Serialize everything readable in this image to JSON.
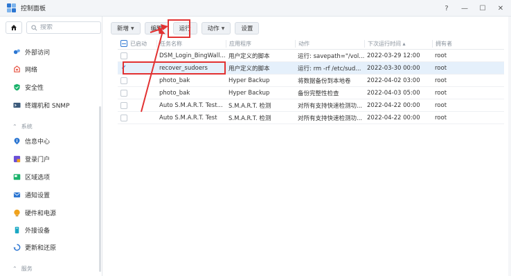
{
  "window": {
    "title": "控制面板"
  },
  "window_controls": {
    "help": "?",
    "minimize": "—",
    "maximize": "☐",
    "close": "✕"
  },
  "sidebar": {
    "search_placeholder": "搜索",
    "partial_top": "外部访问",
    "items": [
      {
        "label": "外部访问",
        "icon": "external-access-icon",
        "color": "#2c76d2"
      },
      {
        "label": "网络",
        "icon": "network-icon",
        "color": "#e7503f"
      },
      {
        "label": "安全性",
        "icon": "security-shield-icon",
        "color": "#1ab26b"
      },
      {
        "label": "终端机和 SNMP",
        "icon": "terminal-icon",
        "color": "#3b5a7a"
      }
    ],
    "section_system": "系统",
    "system_items": [
      {
        "label": "信息中心",
        "icon": "info-center-icon",
        "color": "#2c76d2"
      },
      {
        "label": "登录门户",
        "icon": "login-portal-icon",
        "color": "#6a4fd6"
      },
      {
        "label": "区域选项",
        "icon": "region-icon",
        "color": "#1ab26b"
      },
      {
        "label": "通知设置",
        "icon": "notification-icon",
        "color": "#2c76d2"
      },
      {
        "label": "硬件和电源",
        "icon": "hardware-power-icon",
        "color": "#f0a21c"
      },
      {
        "label": "外接设备",
        "icon": "external-device-icon",
        "color": "#1aa8c4"
      },
      {
        "label": "更新和还原",
        "icon": "update-restore-icon",
        "color": "#2c76d2"
      }
    ],
    "section_services": "服务"
  },
  "toolbar": {
    "create": "新增",
    "edit": "编辑",
    "run": "运行",
    "action": "动作",
    "settings": "设置"
  },
  "table": {
    "headers": {
      "enabled": "已启动",
      "task_name": "任务名称",
      "application": "应用程序",
      "action": "动作",
      "next_run": "下次运行时间",
      "next_run_sort": "▴",
      "owner": "拥有者"
    },
    "rows": [
      {
        "enabled": false,
        "name": "DSM_Login_BingWall...",
        "app": "用户定义的脚本",
        "action": "运行: savepath=\"/vol...",
        "next": "2022-03-29 12:00",
        "owner": "root",
        "selected": false
      },
      {
        "enabled": true,
        "name": "recover_sudoers",
        "app": "用户定义的脚本",
        "action": "运行: rm -rf /etc/sud...",
        "next": "2022-03-30 00:00",
        "owner": "root",
        "selected": true
      },
      {
        "enabled": false,
        "name": "photo_bak",
        "app": "Hyper Backup",
        "action": "将数据备份到本地卷",
        "next": "2022-04-02 03:00",
        "owner": "root",
        "selected": false
      },
      {
        "enabled": false,
        "name": "photo_bak",
        "app": "Hyper Backup",
        "action": "备份完整性检查",
        "next": "2022-04-03 05:00",
        "owner": "root",
        "selected": false
      },
      {
        "enabled": false,
        "name": "Auto S.M.A.R.T. Test...",
        "app": "S.M.A.R.T. 检测",
        "action": "对所有支持快速检测功...",
        "next": "2022-04-22 00:00",
        "owner": "root",
        "selected": false
      },
      {
        "enabled": false,
        "name": "Auto S.M.A.R.T. Test",
        "app": "S.M.A.R.T. 检测",
        "action": "对所有支持快速检测功...",
        "next": "2022-04-22 00:00",
        "owner": "root",
        "selected": false
      }
    ]
  },
  "colors": {
    "accent": "#2c76d2",
    "annotation": "#e23030",
    "selected_row": "#e5f0fb"
  }
}
